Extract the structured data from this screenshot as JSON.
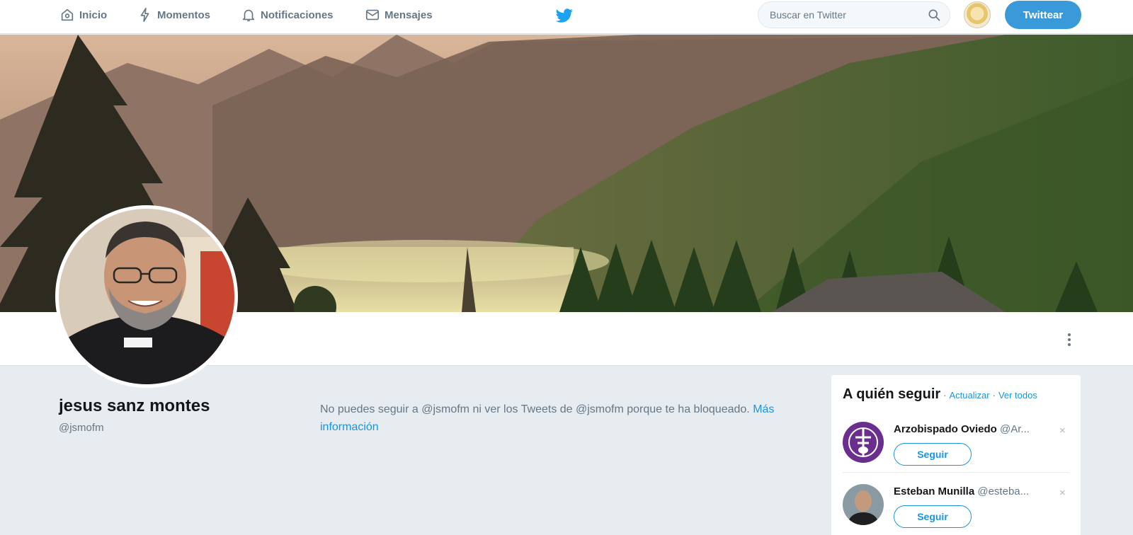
{
  "nav": {
    "items": [
      {
        "label": "Inicio",
        "icon": "home-icon"
      },
      {
        "label": "Momentos",
        "icon": "lightning-icon"
      },
      {
        "label": "Notificaciones",
        "icon": "bell-icon"
      },
      {
        "label": "Mensajes",
        "icon": "mail-icon"
      }
    ],
    "logo_icon": "twitter-bird-icon",
    "search_placeholder": "Buscar en Twitter",
    "tweet_button": "Twittear",
    "accent_color": "#1da1f2"
  },
  "profile": {
    "display_name": "jesus sanz montes",
    "screen_name": "@jsmofm",
    "blocked_message": "No puedes seguir a @jsmofm ni ver los Tweets de @jsmofm porque te ha bloqueado.",
    "more_info_link": "Más información"
  },
  "who_to_follow": {
    "title": "A quién seguir",
    "refresh_link": "Actualizar",
    "view_all_link": "Ver todos",
    "separator": "·",
    "follow_label": "Seguir",
    "close_icon": "×",
    "suggestions": [
      {
        "name": "Arzobispado Oviedo",
        "handle": "@Ar..."
      },
      {
        "name": "Esteban Munilla",
        "handle": "@esteba..."
      }
    ]
  }
}
